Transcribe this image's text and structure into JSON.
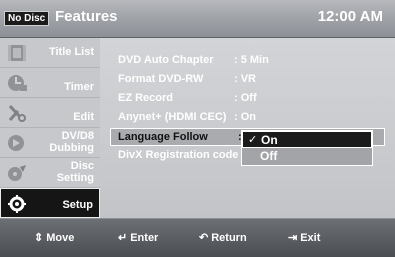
{
  "header": {
    "disc_badge": "No Disc",
    "title": "Features",
    "clock": "12:00 AM"
  },
  "sidebar": {
    "items": [
      {
        "label": "Title List",
        "icon": "film-strip-icon",
        "active": false
      },
      {
        "label": "Timer",
        "icon": "clock-icon",
        "active": false
      },
      {
        "label": "Edit",
        "icon": "scissors-icon",
        "active": false
      },
      {
        "label1": "DV/D8",
        "label2": "Dubbing",
        "icon": "dubbing-icon",
        "active": false
      },
      {
        "label1": "Disc",
        "label2": "Setting",
        "icon": "disc-icon",
        "active": false
      },
      {
        "label": "Setup",
        "icon": "gear-icon",
        "active": true
      }
    ]
  },
  "settings": {
    "rows": [
      {
        "label": "DVD Auto Chapter",
        "value": ": 5 Min"
      },
      {
        "label": "Format DVD-RW",
        "value": ": VR"
      },
      {
        "label": "EZ Record",
        "value": ": Off"
      },
      {
        "label": "Anynet+ (HDMI CEC)",
        "value": ": On"
      },
      {
        "label": "Language Follow",
        "value": ":"
      },
      {
        "label": "DivX Registration code",
        "value": ""
      }
    ]
  },
  "dropdown": {
    "options": [
      "On",
      "Off"
    ],
    "selected": "On",
    "check_mark": "✓"
  },
  "footer": {
    "move": "Move",
    "enter": "Enter",
    "return": "Return",
    "exit": "Exit",
    "move_icon": "up-down-arrow-icon",
    "enter_icon": "enter-icon",
    "return_icon": "return-arrow-icon",
    "exit_icon": "exit-icon"
  },
  "colors": {
    "header_bg": "#a3a6ab",
    "panel_bg": "#c8c9cc",
    "footer_bg": "#55585d",
    "highlight_dark": "#1b1b1b"
  }
}
